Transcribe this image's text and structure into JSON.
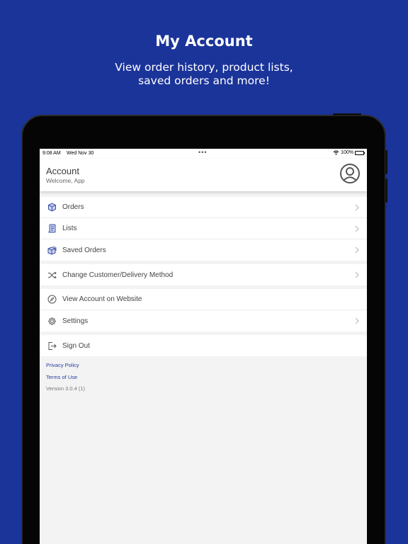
{
  "promo": {
    "title": "My Account",
    "subtitle_line1": "View order history, product lists,",
    "subtitle_line2": "saved orders and more!"
  },
  "status_bar": {
    "time": "9:08 AM",
    "date": "Wed Nov 30",
    "battery": "100%"
  },
  "header": {
    "title": "Account",
    "subtitle": "Welcome, App"
  },
  "menu": {
    "orders": "Orders",
    "lists": "Lists",
    "saved_orders": "Saved Orders",
    "change_customer": "Change Customer/Delivery Method",
    "view_account": "View Account on Website",
    "settings": "Settings",
    "sign_out": "Sign Out"
  },
  "footer": {
    "privacy_policy": "Privacy Policy",
    "terms_of_use": "Terms of Use",
    "version": "Version 3.0.4 (1)"
  },
  "colors": {
    "background": "#1b349a",
    "link": "#2a3d9a",
    "icon_accent": "#3a50a8"
  }
}
